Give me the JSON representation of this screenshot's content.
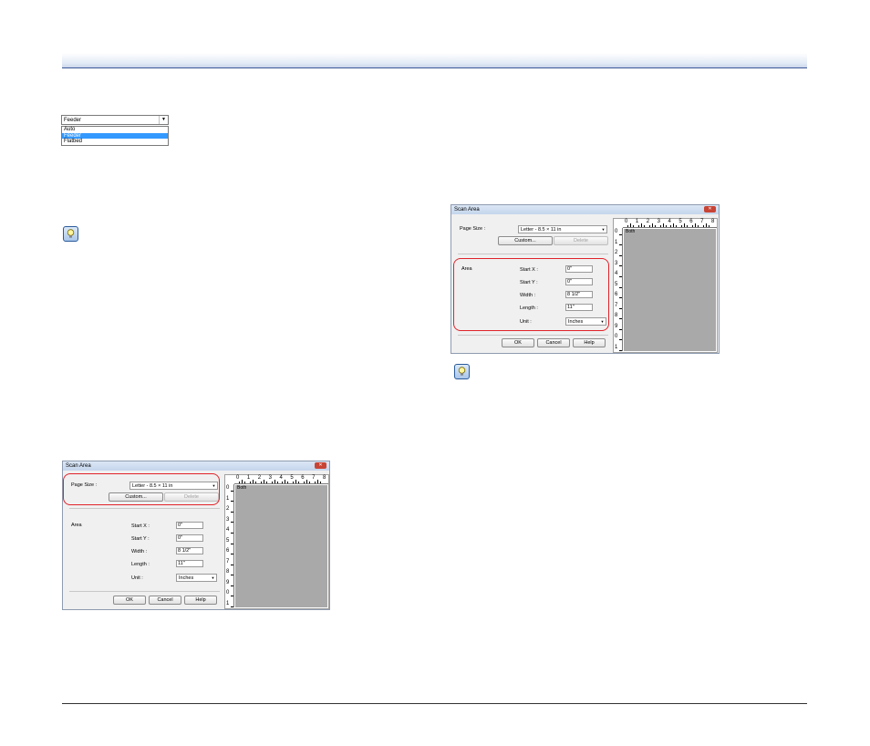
{
  "source_dropdown": {
    "selected": "Feeder",
    "arrow": "▼",
    "options": [
      "Auto",
      "Feeder",
      "Flatbed"
    ]
  },
  "hint_icon": "lightbulb-icon",
  "dialog": {
    "title": "Scan Area",
    "close_glyph": "✕",
    "page_size_label": "Page Size :",
    "page_size_value": "Letter - 8.5 × 11 in",
    "custom_button": "Custom...",
    "delete_button": "Delete",
    "area_label": "Area",
    "start_x_label": "Start X :",
    "start_x_value": "0\"",
    "start_y_label": "Start Y :",
    "start_y_value": "0\"",
    "width_label": "Width :",
    "width_value": "8 1/2\"",
    "length_label": "Length :",
    "length_value": "11\"",
    "unit_label": "Unit :",
    "unit_value": "Inches",
    "ok_button": "OK",
    "cancel_button": "Cancel",
    "help_button": "Help",
    "preview_label": "Both",
    "ruler_h": [
      "0",
      "1",
      "2",
      "3",
      "4",
      "5",
      "6",
      "7",
      "8"
    ],
    "ruler_v": [
      "0",
      "1",
      "2",
      "3",
      "4",
      "5",
      "6",
      "7",
      "8",
      "9",
      "0",
      "1"
    ]
  },
  "colors": {
    "highlight": "#e0232a",
    "selection": "#3399ff",
    "header_rule": "#3c5896"
  }
}
